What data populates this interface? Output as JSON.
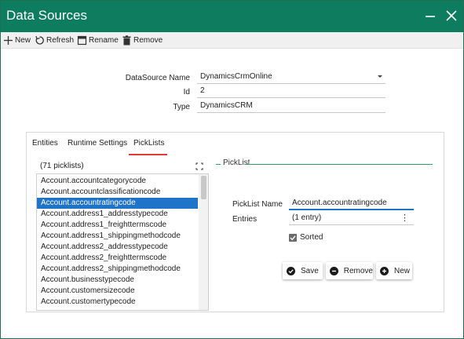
{
  "window": {
    "title": "Data Sources"
  },
  "toolbar": {
    "new_label": "New",
    "refresh_label": "Refresh",
    "rename_label": "Rename",
    "remove_label": "Remove"
  },
  "form": {
    "datasource_name_label": "DataSource Name",
    "datasource_name_value": "DynamicsCrmOnline",
    "id_label": "Id",
    "id_value": "2",
    "type_label": "Type",
    "type_value": "DynamicsCRM"
  },
  "tabs": [
    {
      "label": "Entities"
    },
    {
      "label": "Runtime Settings"
    },
    {
      "label": "PickLists",
      "active": true
    }
  ],
  "picklists": {
    "count_label": "(71 picklists)",
    "items": [
      "Account.accountcategorycode",
      "Account.accountclassificationcode",
      "Account.accountratingcode",
      "Account.address1_addresstypecode",
      "Account.address1_freighttermscode",
      "Account.address1_shippingmethodcode",
      "Account.address2_addresstypecode",
      "Account.address2_freighttermscode",
      "Account.address2_shippingmethodcode",
      "Account.businesstypecode",
      "Account.customersizecode",
      "Account.customertypecode"
    ],
    "selected_index": 2
  },
  "picklist_detail": {
    "legend": "PickList",
    "name_label": "PickList Name",
    "name_value": "Account.accountratingcode",
    "entries_label": "Entries",
    "entries_value": "(1 entry)",
    "sorted_label": "Sorted",
    "sorted_checked": true,
    "save_label": "Save",
    "remove_label": "Remove",
    "new_label": "New"
  },
  "colors": {
    "titlebar": "#0e7d5f",
    "selection": "#1f73c8",
    "tab_underline": "#e03a3a",
    "legend_line": "#2e9e63"
  }
}
